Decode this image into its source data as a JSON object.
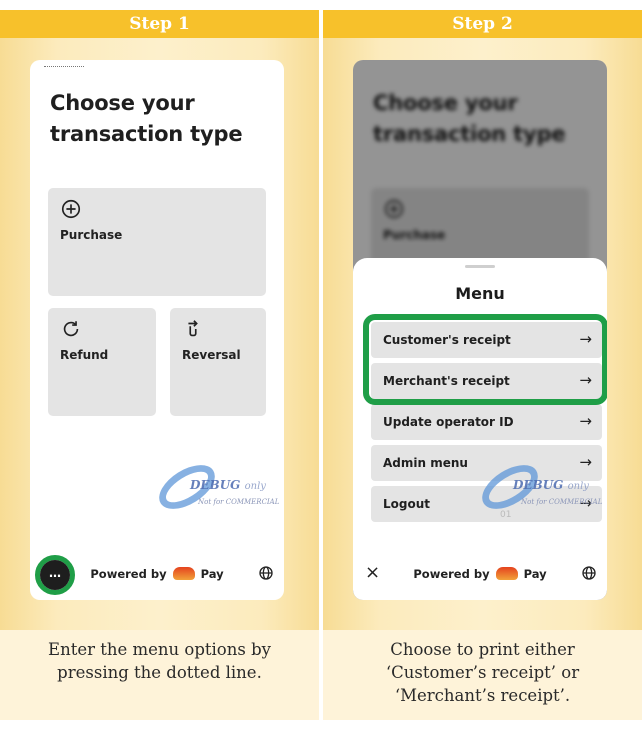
{
  "steps": [
    {
      "header": "Step 1",
      "caption": "Enter the menu options by pressing the dotted line."
    },
    {
      "header": "Step 2",
      "caption_lines": [
        "Choose to print either",
        "‘Customer’s receipt’ or",
        "‘Merchant’s receipt’."
      ]
    }
  ],
  "screen": {
    "title_line1": "Choose your",
    "title_line2": "transaction type",
    "tiles": {
      "purchase": {
        "label": "Purchase",
        "icon": "plus-circle-icon"
      },
      "refund": {
        "label": "Refund",
        "icon": "refresh-icon"
      },
      "reversal": {
        "label": "Reversal",
        "icon": "reversal-icon"
      }
    },
    "footer": {
      "powered_prefix": "Powered by",
      "powered_suffix": "Pay",
      "menu_button": "…",
      "close_button": "×"
    },
    "watermark": {
      "text": "DEBUG",
      "suffix": "only",
      "sub": "Not for COMMERCIAL"
    }
  },
  "menu": {
    "title": "Menu",
    "items": [
      {
        "label": "Customer's receipt"
      },
      {
        "label": "Merchant's receipt"
      },
      {
        "label": "Update operator ID"
      },
      {
        "label": "Admin menu"
      },
      {
        "label": "Logout"
      }
    ],
    "arrow": "→",
    "faint_number": "01"
  },
  "colors": {
    "step_header": "#f7c12b",
    "highlight": "#1f9e47",
    "tile": "#e4e4e4"
  }
}
